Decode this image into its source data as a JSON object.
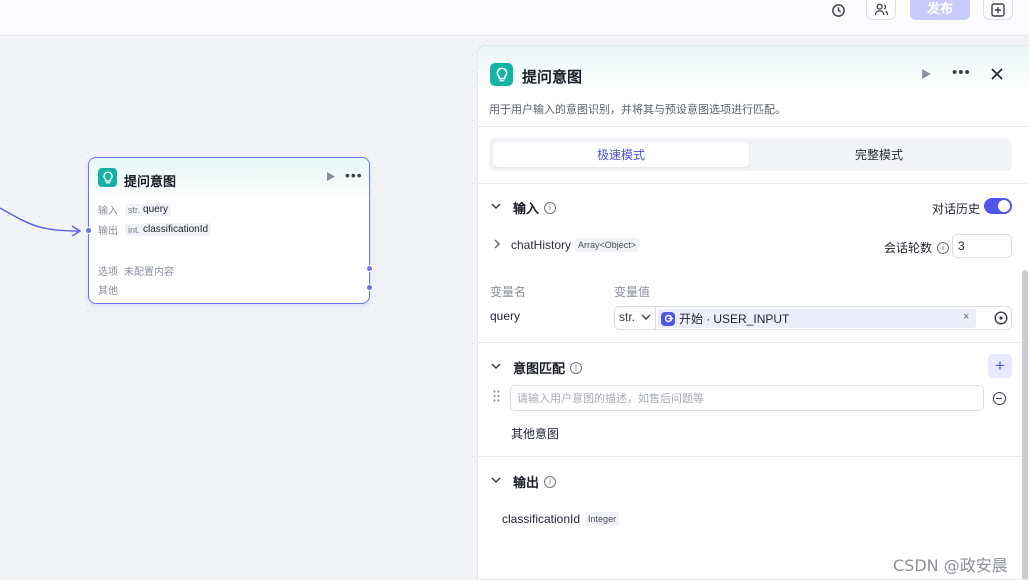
{
  "topbar": {
    "history_icon": "history-icon",
    "users_icon": "users-icon",
    "publish_label": "发布",
    "add_icon": "add-square-icon"
  },
  "node": {
    "title": "提问意图",
    "input_label": "输入",
    "input_type": "str.",
    "input_value": "query",
    "output_label": "输出",
    "output_type": "int.",
    "output_value": "classificationId",
    "options_label": "选项",
    "options_value": "未配置内容",
    "other_label": "其他"
  },
  "panel": {
    "title": "提问意图",
    "description": "用于用户输入的意图识别，并将其与预设意图选项进行匹配。",
    "modes": [
      "极速模式",
      "完整模式"
    ],
    "active_mode": "极速模式",
    "input_section": {
      "title": "输入",
      "history_label": "对话历史",
      "history_on": true,
      "chat_history_name": "chatHistory",
      "chat_history_type": "Array<Object>",
      "rounds_label": "会话轮数",
      "rounds_value": "3",
      "var_name_header": "变量名",
      "var_value_header": "变量值",
      "var_name": "query",
      "var_type": "str.",
      "var_source_prefix": "开始 ·",
      "var_source": "USER_INPUT"
    },
    "intent_section": {
      "title": "意图匹配",
      "placeholder": "请输入用户意图的描述，如售后问题等",
      "other_intent": "其他意图"
    },
    "output_section": {
      "title": "输出",
      "name": "classificationId",
      "type": "Integer"
    }
  },
  "watermark": "CSDN @政安晨",
  "colors": {
    "accent": "#4f55e8",
    "node_icon": "#14b2a4"
  }
}
